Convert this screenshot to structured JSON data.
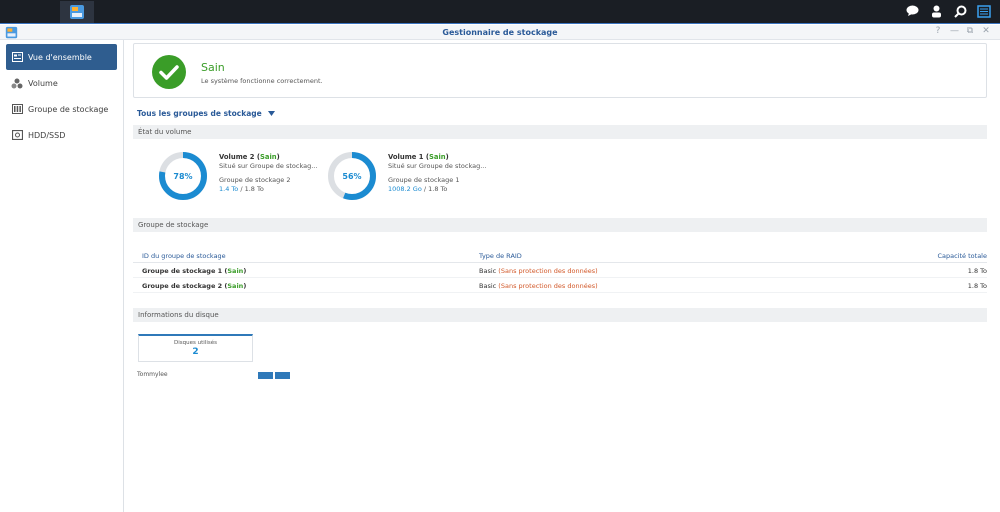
{
  "window": {
    "title": "Gestionnaire de stockage"
  },
  "sidebar": {
    "items": [
      {
        "label": "Vue d'ensemble",
        "icon": "overview-icon",
        "active": true
      },
      {
        "label": "Volume",
        "icon": "volume-icon"
      },
      {
        "label": "Groupe de stockage",
        "icon": "storage-pool-icon"
      },
      {
        "label": "HDD/SSD",
        "icon": "hdd-icon"
      }
    ]
  },
  "status": {
    "title": "Sain",
    "subtitle": "Le système fonctionne correctement."
  },
  "filter": {
    "label": "Tous les groupes de stockage"
  },
  "sections": {
    "volume_state": "État du volume",
    "storage_pool": "Groupe de stockage",
    "disk_info": "Informations du disque"
  },
  "volumes": [
    {
      "name": "Volume 2",
      "status": "Sain",
      "location": "Situé sur Groupe de stockag...",
      "pool": "Groupe de stockage 2",
      "used": "1.4 To",
      "total": "1.8 To",
      "percent_label": "78%",
      "percent": 78
    },
    {
      "name": "Volume 1",
      "status": "Sain",
      "location": "Situé sur Groupe de stockag...",
      "pool": "Groupe de stockage 1",
      "used": "1008.2 Go",
      "total": "1.8 To",
      "percent_label": "56%",
      "percent": 56
    }
  ],
  "pool_table": {
    "headers": [
      "ID du groupe de stockage",
      "Type de RAID",
      "Capacité totale"
    ],
    "rows": [
      {
        "name": "Groupe de stockage 1",
        "status": "Sain",
        "raid": "Basic",
        "raid_note": "Sans protection des données",
        "capacity": "1.8 To"
      },
      {
        "name": "Groupe de stockage 2",
        "status": "Sain",
        "raid": "Basic",
        "raid_note": "Sans protection des données",
        "capacity": "1.8 To"
      }
    ]
  },
  "disks": {
    "label": "Disques utilisés",
    "count": "2",
    "host": "Tommylee",
    "disk_count": 2
  },
  "window_controls": {
    "help": "?",
    "minimize": "—",
    "restore": "⧉",
    "close": "✕"
  },
  "colors": {
    "accent": "#2f5d8f",
    "ok": "#3a9d28",
    "warn": "#d2592a",
    "link": "#1b8bd1"
  }
}
